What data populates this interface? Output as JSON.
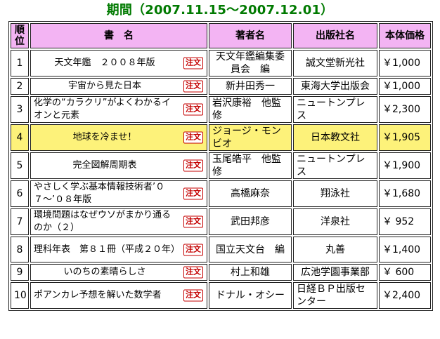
{
  "period_label": "期間（2007.11.15〜2007.12.01）",
  "headers": {
    "rank": "順位",
    "title": "書　名",
    "author": "著者名",
    "publisher": "出版社名",
    "price": "本体価格"
  },
  "order_label": "注文",
  "highlight_color": "#fdf27a",
  "header_color": "#f3b4f3",
  "period_color": "#007a00",
  "rows": [
    {
      "rank": "1",
      "title": "天文年鑑　２００８年版",
      "author": "天文年鑑編集委員会　編",
      "publisher": "誠文堂新光社",
      "price": "￥1,000"
    },
    {
      "rank": "2",
      "title": "宇宙から見た日本",
      "author": "新井田秀一",
      "publisher": "東海大学出版会",
      "price": "￥1,000"
    },
    {
      "rank": "3",
      "title": "化学の“カラクリ”がよくわかるイオンと元素",
      "author": "岩沢康裕　他監修",
      "publisher": "ニュートンプレス",
      "price": "￥2,300"
    },
    {
      "rank": "4",
      "title": "地球を冷ませ！",
      "author": "ジョージ・モンビオ",
      "publisher": "日本教文社",
      "price": "￥1,905"
    },
    {
      "rank": "5",
      "title": "完全図解周期表",
      "author": "玉尾皓平　他監修",
      "publisher": "ニュートンプレス",
      "price": "￥1,900"
    },
    {
      "rank": "6",
      "title": "やさしく学ぶ基本情報技術者’０７〜’０８年版",
      "author": "高橋麻奈",
      "publisher": "翔泳社",
      "price": "￥1,680"
    },
    {
      "rank": "7",
      "title": "環境問題はなぜウソがまかり通るのか（２）",
      "author": "武田邦彦",
      "publisher": "洋泉社",
      "price": "￥ 952"
    },
    {
      "rank": "8",
      "title": "理科年表　第８１冊（平成２０年）",
      "author": "国立天文台　編",
      "publisher": "丸善",
      "price": "￥1,400"
    },
    {
      "rank": "9",
      "title": "いのちの素晴らしさ",
      "author": "村上和雄",
      "publisher": "広池学園事業部",
      "price": "￥ 600"
    },
    {
      "rank": "10",
      "title": "ポアンカレ予想を解いた数学者",
      "author": "ドナル・オシー",
      "publisher": "日経ＢＰ出版センター",
      "price": "￥2,400"
    }
  ]
}
